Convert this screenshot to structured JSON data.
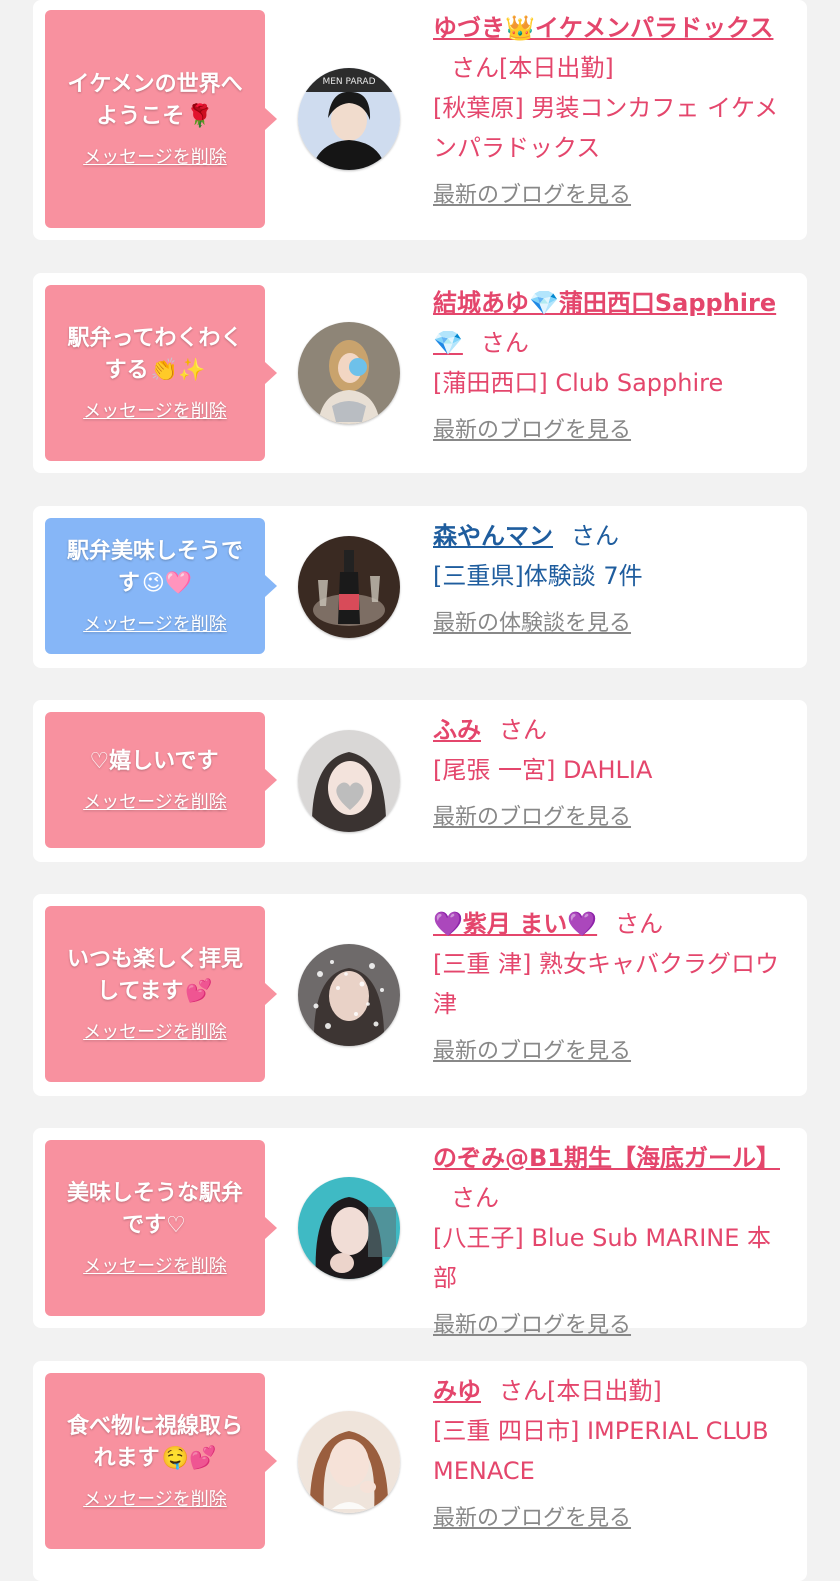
{
  "cards": [
    {
      "theme": "pink",
      "message": "イケメンの世界へようこそ",
      "message_emoji": "🌹",
      "delete_label": "メッセージを削除",
      "name": "ゆづき👑イケメンパラドックス",
      "honorific": "さん",
      "status": "[本日出勤]",
      "shop": "[秋葉原] 男装コンカフェ イケメンパラドックス",
      "blog_link": "最新のブログを見る",
      "avatar_desc": "man-dark-outfit-avatar",
      "avatar_text": "MEN PARAD"
    },
    {
      "theme": "pink",
      "message": "駅弁ってわくわくする",
      "message_emoji": "👏✨",
      "delete_label": "メッセージを削除",
      "name": "結城あゆ💎蒲田西口Sapphire💎",
      "honorific": "さん",
      "status": "",
      "shop": "[蒲田西口] Club Sapphire",
      "blog_link": "最新のブログを見る",
      "avatar_desc": "woman-photo-avatar"
    },
    {
      "theme": "blue",
      "message": "駅弁美味しそうです",
      "message_emoji": "😉🩷",
      "delete_label": "メッセージを削除",
      "name": "森やんマン",
      "honorific": "さん",
      "status": "",
      "shop": "[三重県]体験談 7件",
      "blog_link": "最新の体験談を見る",
      "avatar_desc": "champagne-bottle-avatar"
    },
    {
      "theme": "pink",
      "message": "♡嬉しいです",
      "message_emoji": "",
      "delete_label": "メッセージを削除",
      "name": "ふみ",
      "honorific": "さん",
      "status": "",
      "shop": "[尾張 一宮] DAHLIA",
      "blog_link": "最新のブログを見る",
      "avatar_desc": "woman-heart-face-avatar"
    },
    {
      "theme": "pink",
      "message": "いつも楽しく拝見してます",
      "message_emoji": "💕",
      "delete_label": "メッセージを削除",
      "name": "💜紫月 まい💜",
      "honorific": "さん",
      "status": "",
      "shop": "[三重 津] 熟女キャバクラグロウ津",
      "blog_link": "最新のブログを見る",
      "avatar_desc": "woman-sparkle-avatar"
    },
    {
      "theme": "pink",
      "message": "美味しそうな駅弁です♡",
      "message_emoji": "",
      "delete_label": "メッセージを削除",
      "name": "のぞみ@B1期生【海底ガール】",
      "honorific": "さん",
      "status": "",
      "shop": "[八王子] Blue Sub MARINE 本部",
      "blog_link": "最新のブログを見る",
      "avatar_desc": "woman-portrait-avatar"
    },
    {
      "theme": "pink",
      "message": "食べ物に視線取られます",
      "message_emoji": "🤤💕",
      "delete_label": "メッセージを削除",
      "name": "みゆ",
      "honorific": "さん",
      "status": "[本日出勤]",
      "shop": "[三重 四日市] IMPERIAL CLUB MENACE",
      "blog_link": "最新のブログを見る",
      "avatar_desc": "woman-twin-tails-avatar"
    }
  ],
  "colors": {
    "pink_bubble": "#f8919f",
    "blue_bubble": "#86b6f7",
    "pink_text": "#e4466c",
    "blue_text": "#1f5d9e",
    "link_gray": "#888888",
    "page_bg": "#f2f2f2"
  }
}
